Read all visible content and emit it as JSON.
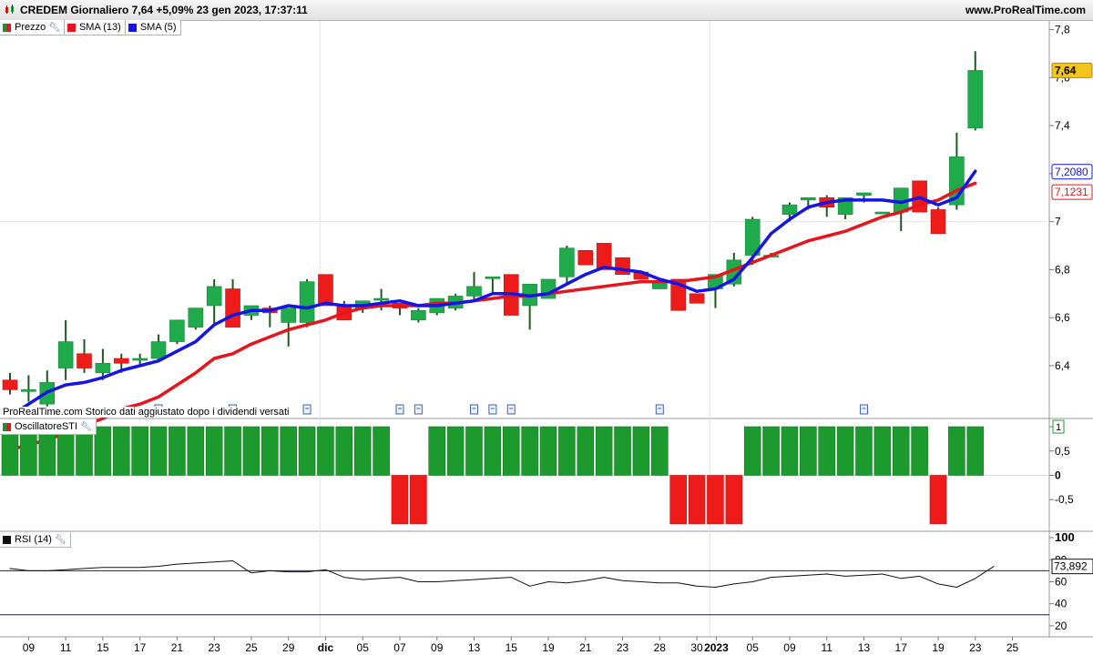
{
  "header": {
    "title": "CREDEM Giornaliero 7,64 +5,09% 23 gen 2023, 17:37:11",
    "site": "www.ProRealTime.com"
  },
  "price_panel": {
    "legend": [
      {
        "label": "Prezzo",
        "color": "#1e8f3c"
      },
      {
        "label": "SMA (13)",
        "color": "#e8141b"
      },
      {
        "label": "SMA (5)",
        "color": "#1414e6"
      }
    ],
    "last_price_badge": "7,64",
    "sma5_badge": "7,2080",
    "sma13_badge": "7,1231",
    "note": "ProRealTime.com Storico dati aggiustato dopo i dividendi versati"
  },
  "osc_panel": {
    "legend": "OscillatoreSTI",
    "last_badge": "1"
  },
  "rsi_panel": {
    "legend": "RSI (14)",
    "last_badge": "73,892"
  },
  "colors": {
    "up": "#1faa4b",
    "down": "#ee1b1b",
    "wick": "#1f5a1f",
    "sma13": "#e8141b",
    "sma5": "#1414e6",
    "osc_up": "#1c9a2e",
    "osc_down": "#ee1b1b"
  },
  "chart_data": [
    {
      "type": "candlestick",
      "series": [
        {
          "name": "Prezzo",
          "ohlc": [
            [
              6.34,
              6.37,
              6.28,
              6.3
            ],
            [
              6.3,
              6.36,
              6.25,
              6.3
            ],
            [
              6.24,
              6.38,
              6.23,
              6.33
            ],
            [
              6.39,
              6.59,
              6.34,
              6.5
            ],
            [
              6.45,
              6.51,
              6.37,
              6.39
            ],
            [
              6.37,
              6.47,
              6.34,
              6.41
            ],
            [
              6.43,
              6.45,
              6.37,
              6.41
            ],
            [
              6.43,
              6.45,
              6.4,
              6.43
            ],
            [
              6.43,
              6.53,
              6.42,
              6.5
            ],
            [
              6.5,
              6.56,
              6.49,
              6.59
            ],
            [
              6.56,
              6.64,
              6.55,
              6.64
            ],
            [
              6.65,
              6.76,
              6.57,
              6.73
            ],
            [
              6.72,
              6.76,
              6.56,
              6.56
            ],
            [
              6.61,
              6.65,
              6.59,
              6.65
            ],
            [
              6.64,
              6.65,
              6.56,
              6.62
            ],
            [
              6.58,
              6.64,
              6.48,
              6.64
            ],
            [
              6.58,
              6.76,
              6.56,
              6.75
            ],
            [
              6.78,
              6.78,
              6.65,
              6.65
            ],
            [
              6.65,
              6.67,
              6.59,
              6.59
            ],
            [
              6.64,
              6.67,
              6.62,
              6.67
            ],
            [
              6.68,
              6.72,
              6.63,
              6.68
            ],
            [
              6.66,
              6.66,
              6.61,
              6.64
            ],
            [
              6.59,
              6.64,
              6.58,
              6.63
            ],
            [
              6.62,
              6.68,
              6.61,
              6.68
            ],
            [
              6.64,
              6.7,
              6.63,
              6.69
            ],
            [
              6.69,
              6.79,
              6.67,
              6.73
            ],
            [
              6.77,
              6.77,
              6.7,
              6.77
            ],
            [
              6.78,
              6.78,
              6.61,
              6.61
            ],
            [
              6.65,
              6.72,
              6.55,
              6.74
            ],
            [
              6.68,
              6.76,
              6.68,
              6.76
            ],
            [
              6.77,
              6.9,
              6.74,
              6.89
            ],
            [
              6.88,
              6.88,
              6.82,
              6.82
            ],
            [
              6.91,
              6.91,
              6.8,
              6.8
            ],
            [
              6.85,
              6.85,
              6.78,
              6.78
            ],
            [
              6.79,
              6.79,
              6.76,
              6.76
            ],
            [
              6.72,
              6.75,
              6.72,
              6.75
            ],
            [
              6.76,
              6.76,
              6.63,
              6.63
            ],
            [
              6.7,
              6.7,
              6.66,
              6.66
            ],
            [
              6.72,
              6.77,
              6.64,
              6.78
            ],
            [
              6.74,
              6.87,
              6.73,
              6.84
            ],
            [
              6.86,
              7.02,
              6.82,
              7.01
            ],
            [
              6.86,
              6.87,
              6.86,
              6.86
            ],
            [
              7.03,
              7.08,
              7.0,
              7.07
            ],
            [
              7.09,
              7.1,
              7.05,
              7.1
            ],
            [
              7.1,
              7.11,
              7.02,
              7.06
            ],
            [
              7.03,
              7.09,
              7.01,
              7.1
            ],
            [
              7.11,
              7.12,
              7.08,
              7.12
            ],
            [
              7.04,
              7.04,
              7.04,
              7.04
            ],
            [
              7.04,
              7.14,
              6.96,
              7.14
            ],
            [
              7.17,
              7.17,
              7.04,
              7.04
            ],
            [
              7.05,
              7.06,
              6.95,
              6.95
            ],
            [
              7.07,
              7.37,
              7.05,
              7.27
            ],
            [
              7.39,
              7.71,
              7.38,
              7.63
            ]
          ]
        },
        {
          "name": "SMA (13)",
          "values": [
            6.05,
            6.07,
            6.09,
            6.12,
            6.15,
            6.18,
            6.22,
            6.24,
            6.27,
            6.32,
            6.37,
            6.43,
            6.45,
            6.49,
            6.52,
            6.55,
            6.57,
            6.59,
            6.62,
            6.64,
            6.65,
            6.65,
            6.65,
            6.66,
            6.66,
            6.67,
            6.68,
            6.69,
            6.69,
            6.7,
            6.71,
            6.72,
            6.73,
            6.74,
            6.75,
            6.75,
            6.75,
            6.76,
            6.77,
            6.8,
            6.83,
            6.86,
            6.89,
            6.92,
            6.94,
            6.96,
            6.99,
            7.02,
            7.04,
            7.07,
            7.09,
            7.13,
            7.16
          ]
        },
        {
          "name": "SMA (5)",
          "values": [
            6.19,
            6.24,
            6.29,
            6.32,
            6.33,
            6.35,
            6.38,
            6.4,
            6.42,
            6.46,
            6.5,
            6.57,
            6.61,
            6.63,
            6.63,
            6.65,
            6.64,
            6.66,
            6.65,
            6.65,
            6.66,
            6.67,
            6.65,
            6.65,
            6.66,
            6.67,
            6.7,
            6.7,
            6.69,
            6.7,
            6.74,
            6.78,
            6.81,
            6.8,
            6.79,
            6.76,
            6.74,
            6.71,
            6.72,
            6.76,
            6.85,
            6.95,
            7.01,
            7.06,
            7.08,
            7.09,
            7.09,
            7.09,
            7.08,
            7.1,
            7.07,
            7.1,
            7.21
          ]
        }
      ],
      "ylim": [
        6.18,
        7.84
      ],
      "yticks": [
        6.4,
        6.6,
        6.8,
        7.0,
        7.2,
        7.4,
        7.6,
        7.8
      ],
      "ytick_labels": [
        "6,4",
        "6,6",
        "6,8",
        "7",
        "7,2",
        "7,4",
        "7,6",
        "7,8"
      ],
      "xtick_labels": [
        "09",
        "11",
        "15",
        "17",
        "21",
        "23",
        "25",
        "29",
        "dic",
        "05",
        "07",
        "09",
        "13",
        "15",
        "19",
        "21",
        "23",
        "28",
        "30",
        "2023",
        "05",
        "09",
        "11",
        "13",
        "17",
        "19",
        "23",
        "25"
      ]
    },
    {
      "type": "bar",
      "name": "OscillatoreSTI",
      "values": [
        1,
        1,
        1,
        1,
        1,
        1,
        1,
        1,
        1,
        1,
        1,
        1,
        1,
        1,
        1,
        1,
        1,
        1,
        1,
        1,
        1,
        -1,
        -1,
        1,
        1,
        1,
        1,
        1,
        1,
        1,
        1,
        1,
        1,
        1,
        1,
        1,
        -1,
        -1,
        -1,
        -1,
        1,
        1,
        1,
        1,
        1,
        1,
        1,
        1,
        1,
        1,
        -1,
        1,
        1
      ],
      "ylim": [
        -1.15,
        1.15
      ],
      "ytick_labels": [
        "1",
        "0,5",
        "0",
        "-0,5"
      ]
    },
    {
      "type": "line",
      "name": "RSI (14)",
      "values": [
        72,
        70,
        70,
        71,
        72,
        73,
        73,
        73,
        74,
        76,
        77,
        78,
        79,
        68,
        70,
        69,
        69,
        71,
        64,
        62,
        63,
        64,
        60,
        60,
        61,
        62,
        63,
        64,
        56,
        60,
        59,
        61,
        64,
        61,
        60,
        59,
        59,
        56,
        55,
        58,
        60,
        64,
        65,
        66,
        67,
        65,
        66,
        67,
        63,
        65,
        58,
        55,
        63,
        73.9
      ],
      "ylim": [
        10,
        105
      ],
      "yticks": [
        20,
        40,
        60,
        80,
        100
      ],
      "ytick_labels": [
        "20",
        "40",
        "60",
        "80",
        "100"
      ],
      "levels": [
        70,
        30
      ]
    }
  ]
}
